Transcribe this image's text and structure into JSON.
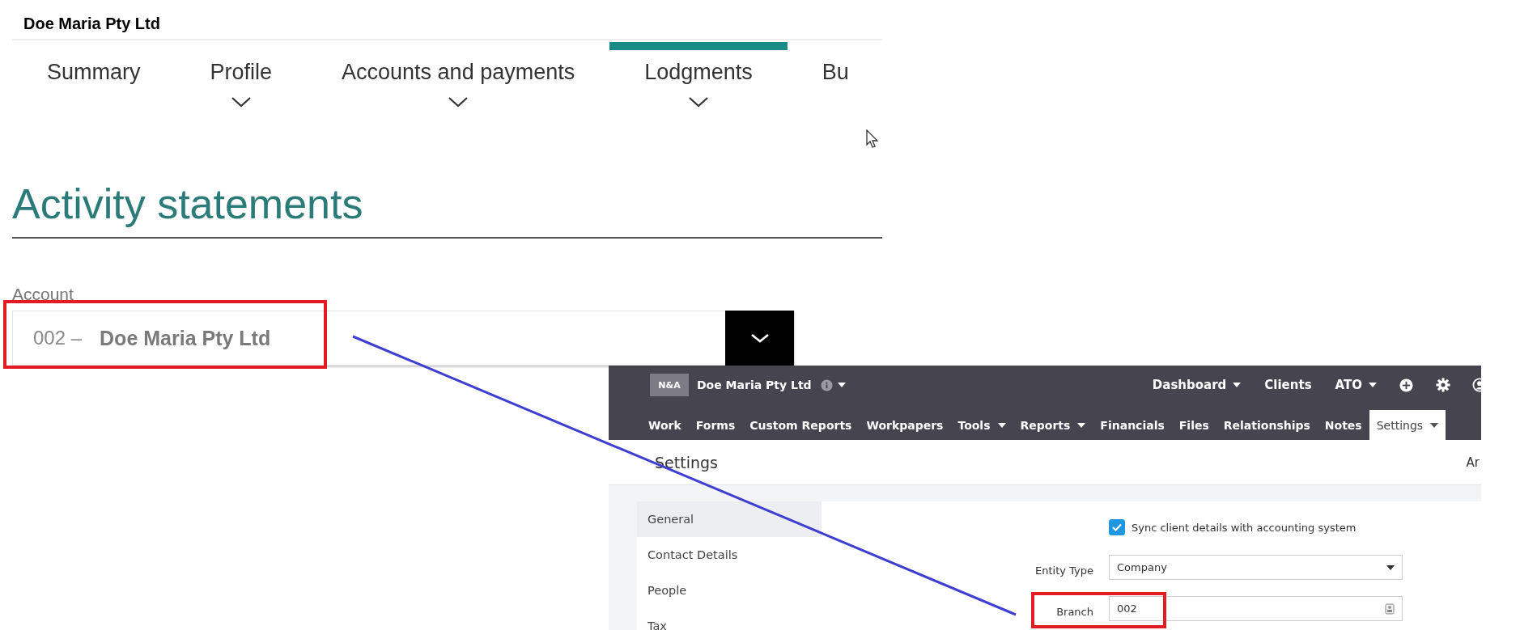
{
  "portal": {
    "org_name": "Doe Maria Pty Ltd",
    "tabs": [
      {
        "label": "Summary",
        "selected": false,
        "has_menu": false
      },
      {
        "label": "Profile",
        "selected": false,
        "has_menu": true
      },
      {
        "label": "Accounts and payments",
        "selected": false,
        "has_menu": true
      },
      {
        "label": "Lodgments",
        "selected": true,
        "has_menu": true
      },
      {
        "label": "Bu",
        "selected": false,
        "has_menu": false
      }
    ],
    "heading": "Activity statements",
    "account": {
      "label": "Account",
      "number": "002 –",
      "name": "Doe Maria Pty Ltd"
    }
  },
  "practice_app": {
    "logo": "N&A",
    "client": "Doe Maria Pty Ltd",
    "top_nav": [
      {
        "label": "Dashboard",
        "dropdown": true
      },
      {
        "label": "Clients",
        "dropdown": false
      },
      {
        "label": "ATO",
        "dropdown": true
      }
    ],
    "menu": [
      {
        "label": "Work",
        "selected": false,
        "dropdown": false
      },
      {
        "label": "Forms",
        "selected": false,
        "dropdown": false
      },
      {
        "label": "Custom Reports",
        "selected": false,
        "dropdown": false
      },
      {
        "label": "Workpapers",
        "selected": false,
        "dropdown": false
      },
      {
        "label": "Tools",
        "selected": false,
        "dropdown": true
      },
      {
        "label": "Reports",
        "selected": false,
        "dropdown": true
      },
      {
        "label": "Financials",
        "selected": false,
        "dropdown": false
      },
      {
        "label": "Files",
        "selected": false,
        "dropdown": false
      },
      {
        "label": "Relationships",
        "selected": false,
        "dropdown": false
      },
      {
        "label": "Notes",
        "selected": false,
        "dropdown": false
      },
      {
        "label": "Settings",
        "selected": true,
        "dropdown": true
      }
    ],
    "page_title": "Settings",
    "right_text": "Ar",
    "sidebar": [
      {
        "label": "General",
        "selected": true
      },
      {
        "label": "Contact Details",
        "selected": false
      },
      {
        "label": "People",
        "selected": false
      },
      {
        "label": "Tax",
        "selected": false
      }
    ],
    "sync": {
      "label": "Sync client details with accounting system",
      "checked": true
    },
    "fields": [
      {
        "label": "Entity Type",
        "value": "Company",
        "kind": "select"
      },
      {
        "label": "Branch",
        "value": "002",
        "kind": "input"
      }
    ]
  }
}
